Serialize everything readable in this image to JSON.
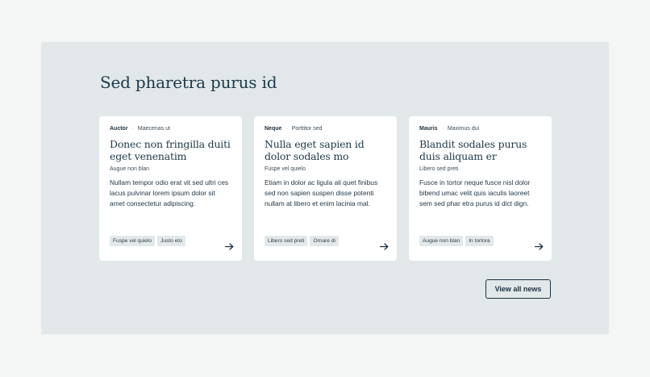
{
  "section": {
    "title": "Sed pharetra purus id",
    "view_all_label": "View all news"
  },
  "cards": [
    {
      "category": "Auctor",
      "meta": "Maecenas ut",
      "title": "Donec non fringilla duiti eget venenatim",
      "subtitle": "Augue non blan",
      "body": "Nullam tempor odio erat vit sed ultri ces lacus pulvinar lorem ipsum dolor sit amet consectetur adipiscing.",
      "tags": [
        "Fuspe vel quielo",
        "Justo eto"
      ],
      "arrow_icon": "arrow-right-icon"
    },
    {
      "category": "Neque",
      "meta": "Porttitor sed",
      "title": "Nulla eget sapien id dolor sodales mo",
      "subtitle": "Fuspe vel quielo",
      "body": "Etiam in dolor ac ligula ali quet finibus sed non sapien suspen disse potenti nullam at libero et enim lacinia mal.",
      "tags": [
        "Libero sed preti",
        "Ornare di"
      ],
      "arrow_icon": "arrow-right-icon"
    },
    {
      "category": "Mauris",
      "meta": "Maximus dui",
      "title": "Blandit sodales purus duis aliquam er",
      "subtitle": "Libero sed preti",
      "body": "Fusce in tortor neque fusce nisl dolor bibend umac velit quis iaculis laoreet sem sed phar etra purus id dict dign.",
      "tags": [
        "Augue non blan",
        "In tortora"
      ],
      "arrow_icon": "arrow-right-icon"
    }
  ],
  "colors": {
    "page_bg": "#f4f6f6",
    "section_bg": "#e2e8e9",
    "card_bg": "#ffffff",
    "tag_bg": "#e3e8ea",
    "text_primary": "#1d3040"
  }
}
